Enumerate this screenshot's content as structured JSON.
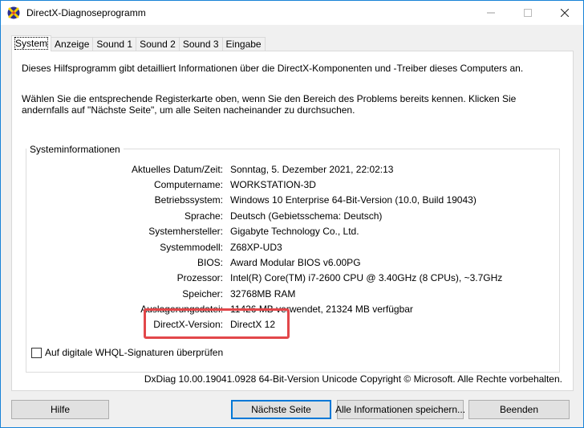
{
  "window": {
    "title": "DirectX-Diagnoseprogramm",
    "icon": "directx-icon"
  },
  "tabs": [
    {
      "label": "System",
      "active": true
    },
    {
      "label": "Anzeige"
    },
    {
      "label": "Sound 1"
    },
    {
      "label": "Sound 2"
    },
    {
      "label": "Sound 3"
    },
    {
      "label": "Eingabe"
    }
  ],
  "intro": {
    "line1": "Dieses Hilfsprogramm gibt detailliert Informationen über die DirectX-Komponenten und -Treiber dieses Computers an.",
    "line2": "Wählen Sie die entsprechende Registerkarte oben, wenn Sie den Bereich des Problems bereits kennen. Klicken Sie andernfalls auf \"Nächste Seite\", um alle Seiten nacheinander zu durchsuchen."
  },
  "system_info": {
    "legend": "Systeminformationen",
    "rows": [
      {
        "label": "Aktuelles Datum/Zeit:",
        "value": "Sonntag, 5. Dezember 2021, 22:02:13"
      },
      {
        "label": "Computername:",
        "value": "WORKSTATION-3D"
      },
      {
        "label": "Betriebssystem:",
        "value": "Windows 10 Enterprise 64-Bit-Version (10.0, Build 19043)"
      },
      {
        "label": "Sprache:",
        "value": "Deutsch (Gebietsschema: Deutsch)"
      },
      {
        "label": "Systemhersteller:",
        "value": "Gigabyte Technology Co., Ltd."
      },
      {
        "label": "Systemmodell:",
        "value": "Z68XP-UD3"
      },
      {
        "label": "BIOS:",
        "value": "Award Modular BIOS v6.00PG"
      },
      {
        "label": "Prozessor:",
        "value": "Intel(R) Core(TM) i7-2600 CPU @ 3.40GHz (8 CPUs), ~3.7GHz"
      },
      {
        "label": "Speicher:",
        "value": "32768MB RAM"
      },
      {
        "label": "Auslagerungsdatei:",
        "value": "11426 MB verwendet, 21324 MB verfügbar"
      },
      {
        "label": "DirectX-Version:",
        "value": "DirectX 12"
      }
    ]
  },
  "checkbox": {
    "label": "Auf digitale WHQL-Signaturen überprüfen",
    "checked": false
  },
  "copyright": "DxDiag 10.00.19041.0928 64-Bit-Version Unicode Copyright © Microsoft. Alle Rechte vorbehalten.",
  "buttons": {
    "help": "Hilfe",
    "next": "Nächste Seite",
    "save": "Alle Informationen speichern...",
    "exit": "Beenden"
  },
  "colors": {
    "highlight": "#e2474a",
    "accent": "#0078d7"
  }
}
